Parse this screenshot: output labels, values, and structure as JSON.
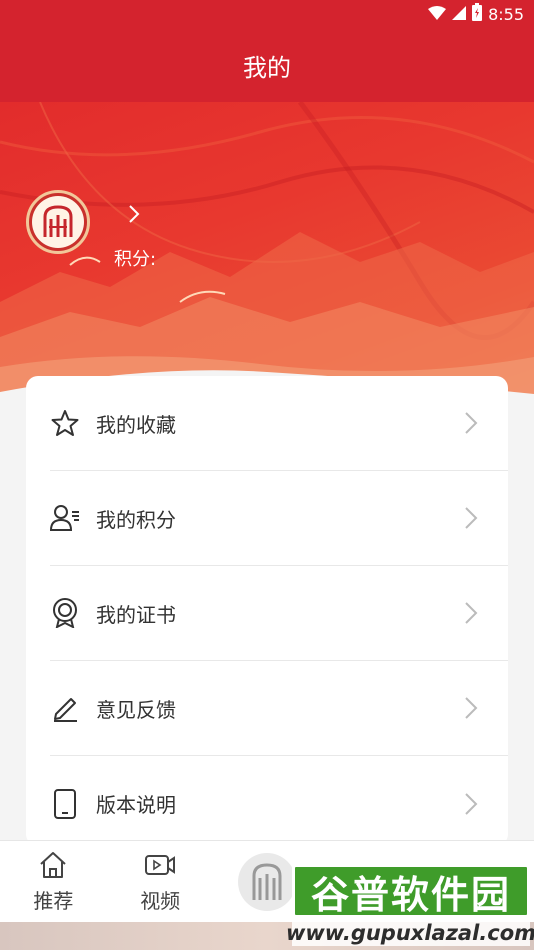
{
  "status_bar": {
    "time": "8:55"
  },
  "header": {
    "title": "我的"
  },
  "profile": {
    "points_label": "积分:"
  },
  "menu": [
    {
      "label": "我的收藏",
      "icon": "star-icon"
    },
    {
      "label": "我的积分",
      "icon": "user-points-icon"
    },
    {
      "label": "我的证书",
      "icon": "certificate-icon"
    },
    {
      "label": "意见反馈",
      "icon": "pen-icon"
    },
    {
      "label": "版本说明",
      "icon": "phone-icon"
    }
  ],
  "tabs": [
    {
      "label": "推荐",
      "icon": "home-icon"
    },
    {
      "label": "视频",
      "icon": "video-icon"
    },
    {
      "label": "",
      "icon": "logo-icon"
    },
    {
      "label": "",
      "icon": "grid-icon"
    },
    {
      "label": "",
      "icon": "person-icon"
    }
  ],
  "watermark": {
    "top": "谷普软件园",
    "bottom": "www.gupuxlazal.com"
  },
  "colors": {
    "primary": "#d4232e",
    "card": "#ffffff",
    "background": "#f4f4f4"
  }
}
